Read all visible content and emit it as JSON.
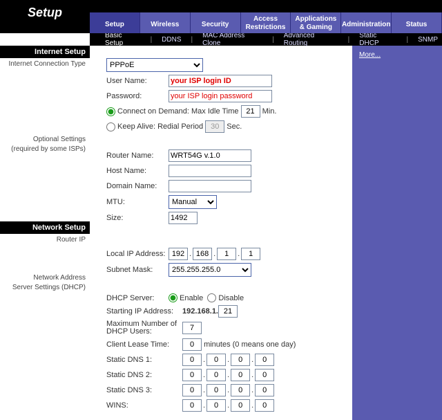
{
  "logo": "Setup",
  "mainnav": [
    "Setup",
    "Wireless",
    "Security",
    "Access\nRestrictions",
    "Applications\n& Gaming",
    "Administration",
    "Status"
  ],
  "subnav": [
    "Basic Setup",
    "DDNS",
    "MAC Address Clone",
    "Advanced Routing",
    "Static DHCP",
    "SNMP"
  ],
  "sidebar": {
    "internet_setup": "Internet Setup",
    "conn_type": "Internet Connection Type",
    "optional": "Optional Settings",
    "optional2": "(required by some ISPs)",
    "network_setup": "Network Setup",
    "router_ip": "Router IP",
    "nas": "Network Address",
    "nas2": "Server Settings (DHCP)"
  },
  "conn": {
    "type": "PPPoE",
    "user_label": "User Name:",
    "user_value": "your ISP login ID",
    "pass_label": "Password:",
    "pass_value": "your ISP login password",
    "cod_label": "Connect on Demand: Max Idle Time",
    "cod_value": "21",
    "cod_unit": "Min.",
    "ka_label": "Keep Alive: Redial Period",
    "ka_value": "30",
    "ka_unit": "Sec."
  },
  "opt": {
    "router_label": "Router Name:",
    "router_value": "WRT54G v.1.0",
    "host_label": "Host Name:",
    "domain_label": "Domain Name:",
    "mtu_label": "MTU:",
    "mtu_mode": "Manual",
    "size_label": "Size:",
    "size_value": "1492"
  },
  "ip": {
    "local_label": "Local IP Address:",
    "ip1": "192",
    "ip2": "168",
    "ip3": "1",
    "ip4": "1",
    "subnet_label": "Subnet Mask:",
    "subnet": "255.255.255.0"
  },
  "dhcp": {
    "server_label": "DHCP Server:",
    "enable": "Enable",
    "disable": "Disable",
    "start_label": "Starting IP Address:",
    "start_prefix": "192.168.1.",
    "start_value": "21",
    "max_label": "Maximum Number of DHCP Users:",
    "max_value": "7",
    "lease_label": "Client Lease Time:",
    "lease_value": "0",
    "lease_note": "minutes (0 means one day)",
    "dns1_label": "Static DNS 1:",
    "dns2_label": "Static DNS 2:",
    "dns3_label": "Static DNS 3:",
    "wins_label": "WINS:",
    "zero": "0"
  },
  "more": "More..."
}
